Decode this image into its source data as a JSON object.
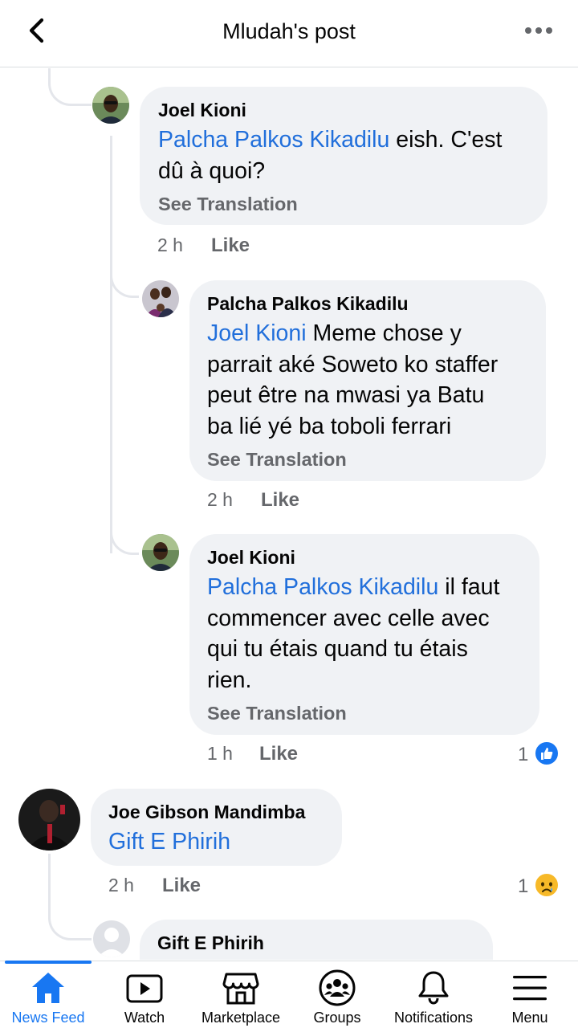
{
  "header": {
    "title": "Mludah's post",
    "back_icon": "chevron-left-icon",
    "more_icon": "more-horizontal-icon"
  },
  "comments": [
    {
      "author": "Joel Kioni",
      "mention": "Palcha Palkos Kikadilu",
      "text_lines": [
        "eish. C'est",
        "dû à quoi?"
      ],
      "see_translation": "See Translation",
      "time": "2 h",
      "like": "Like"
    },
    {
      "author": "Palcha Palkos Kikadilu",
      "mention": "Joel Kioni",
      "text_lines": [
        "Meme chose y",
        "parrait aké Soweto ko staffer",
        "peut être na mwasi ya Batu",
        "ba lié yé ba toboli ferrari"
      ],
      "see_translation": "See Translation",
      "time": "2 h",
      "like": "Like"
    },
    {
      "author": "Joel Kioni",
      "mention": "Palcha Palkos Kikadilu",
      "text_lines": [
        "il faut",
        "commencer avec celle avec",
        "qui tu étais quand tu étais",
        "rien."
      ],
      "see_translation": "See Translation",
      "time": "1 h",
      "like": "Like",
      "reaction_count": "1",
      "reaction_icon": "like-reaction-icon"
    },
    {
      "author": "Joe Gibson Mandimba",
      "mention": "Gift E Phirih",
      "time": "2 h",
      "like": "Like",
      "reaction_count": "1",
      "reaction_icon": "sad-reaction-icon"
    },
    {
      "author": "Gift E Phirih"
    }
  ],
  "nav": {
    "items": [
      {
        "label": "News Feed",
        "icon": "home-icon",
        "active": true
      },
      {
        "label": "Watch",
        "icon": "watch-icon"
      },
      {
        "label": "Marketplace",
        "icon": "marketplace-icon"
      },
      {
        "label": "Groups",
        "icon": "groups-icon"
      },
      {
        "label": "Notifications",
        "icon": "bell-icon"
      },
      {
        "label": "Menu",
        "icon": "menu-icon"
      }
    ]
  },
  "colors": {
    "accent": "#1877f2",
    "mention": "#216fdb",
    "bubble": "#f0f2f5",
    "secondary_text": "#65676b"
  }
}
